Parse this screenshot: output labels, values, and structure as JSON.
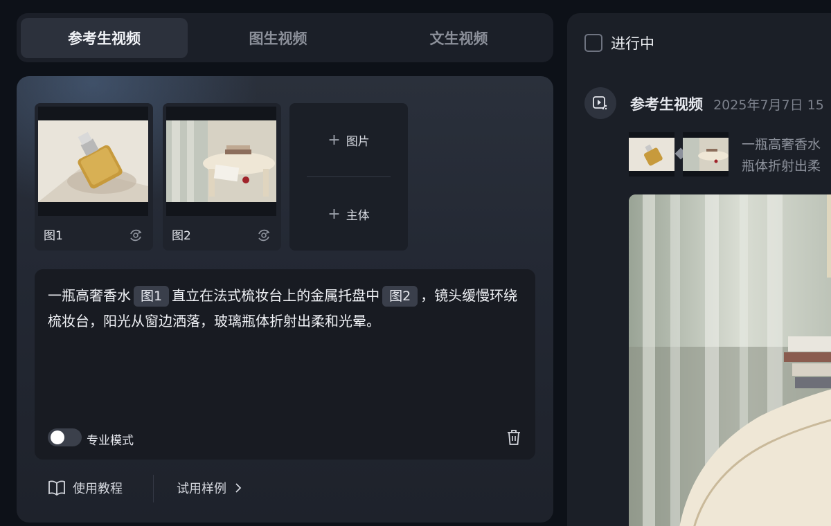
{
  "tabs": [
    {
      "label": "参考生视频",
      "active": true
    },
    {
      "label": "图生视频",
      "active": false
    },
    {
      "label": "文生视频",
      "active": false
    }
  ],
  "references": [
    {
      "label": "图1",
      "icon": "swap-icon"
    },
    {
      "label": "图2",
      "icon": "swap-icon"
    }
  ],
  "add_menu": {
    "image_label": "图片",
    "subject_label": "主体"
  },
  "prompt": {
    "part1": "一瓶高奢香水",
    "tag1": "图1",
    "part2": "直立在法式梳妆台上的金属托盘中",
    "tag2": "图2",
    "part3": "，镜头缓慢环绕梳妆台，阳光从窗边洒落，玻璃瓶体折射出柔和光晕。"
  },
  "pro_mode": {
    "label": "专业模式",
    "enabled": false
  },
  "bottom": {
    "tutorial_label": "使用教程",
    "examples_label": "试用样例"
  },
  "right": {
    "filter_label": "进行中",
    "task": {
      "title": "参考生视频",
      "time": "2025年7月7日 15",
      "prompt_line1": "一瓶高奢香水",
      "prompt_line2": "瓶体折射出柔"
    }
  },
  "colors": {
    "background": "#0d1118",
    "panel": "#1b1f27",
    "tag": "#3a3f4b",
    "active_tab": "#2c313c"
  }
}
